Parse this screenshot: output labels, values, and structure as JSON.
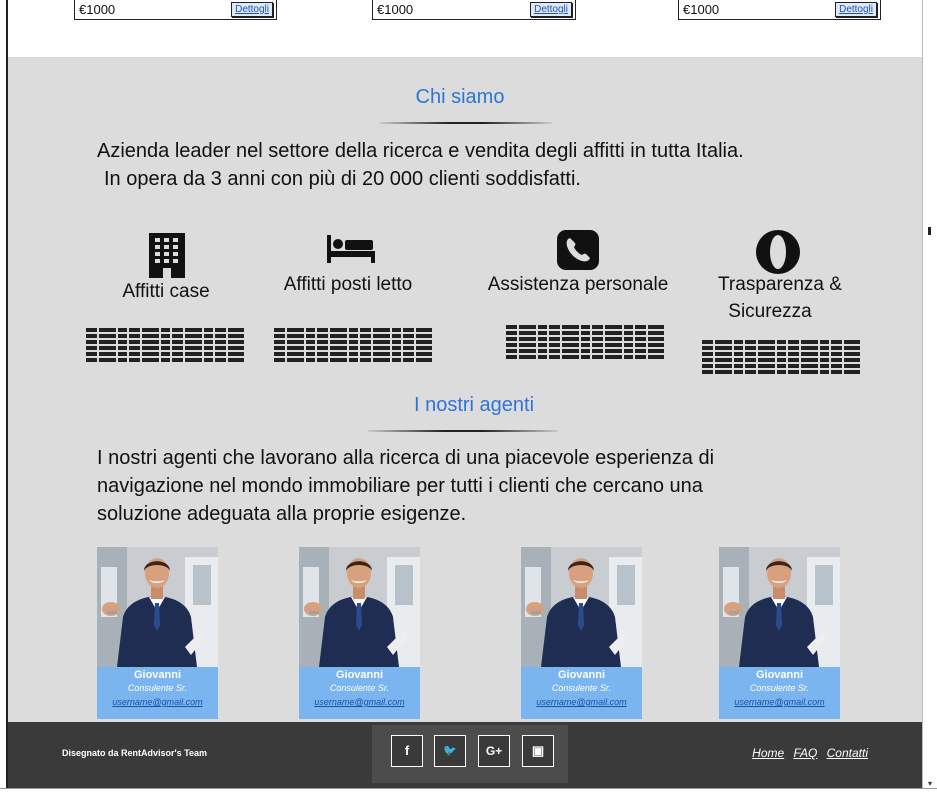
{
  "listings": [
    {
      "price": "€1000",
      "details_label": "Dettogli"
    },
    {
      "price": "€1000",
      "details_label": "Dettogli"
    },
    {
      "price": "€1000",
      "details_label": "Dettogli"
    }
  ],
  "about": {
    "title": "Chi siamo",
    "text_line1": "Azienda leader nel settore della ricerca e vendita degli affitti in tutta Italia.",
    "text_line2": "In opera da 3 anni con più di 20 000 clienti soddisfatti."
  },
  "features": [
    {
      "icon": "building-icon",
      "label": "Affitti case"
    },
    {
      "icon": "bed-icon",
      "label": "Affitti posti letto"
    },
    {
      "icon": "phone-icon",
      "label": "Assistenza personale"
    },
    {
      "icon": "opera-icon",
      "label_line1": "Trasparenza &",
      "label_line2": "Sicurezza"
    }
  ],
  "agents_section": {
    "title": "I nostri agenti",
    "text_line1": "I nostri agenti che lavorano alla ricerca di una piacevole esperienza di",
    "text_line2": "navigazione nel mondo immobiliare per tutti i clienti che cercano una",
    "text_line3": "soluzione adeguata alla proprie esigenze."
  },
  "agents": [
    {
      "name": "Giovanni",
      "role": "Consulente Sr.",
      "email": "username@gmail.com"
    },
    {
      "name": "Giovanni",
      "role": "Consulente Sr.",
      "email": "username@gmail.com"
    },
    {
      "name": "Giovanni",
      "role": "Consulente Sr.",
      "email": "username@gmail.com"
    },
    {
      "name": "Giovanni",
      "role": "Consulente Sr.",
      "email": "username@gmail.com"
    }
  ],
  "footer": {
    "credit": "Disegnato da RentAdvisor's Team",
    "social": [
      {
        "icon": "facebook-icon",
        "glyph": "f"
      },
      {
        "icon": "twitter-icon",
        "glyph": "🐦"
      },
      {
        "icon": "google-plus-icon",
        "glyph": "G+"
      },
      {
        "icon": "youtube-icon",
        "glyph": "▣"
      }
    ],
    "links": {
      "home": "Home",
      "faq": "FAQ",
      "contacts": "Contatti"
    }
  },
  "colors": {
    "accent": "#2f74d8",
    "background": "#dcdcdc",
    "footer": "#3a3a3a",
    "agent_card": "#7bb5ef"
  }
}
